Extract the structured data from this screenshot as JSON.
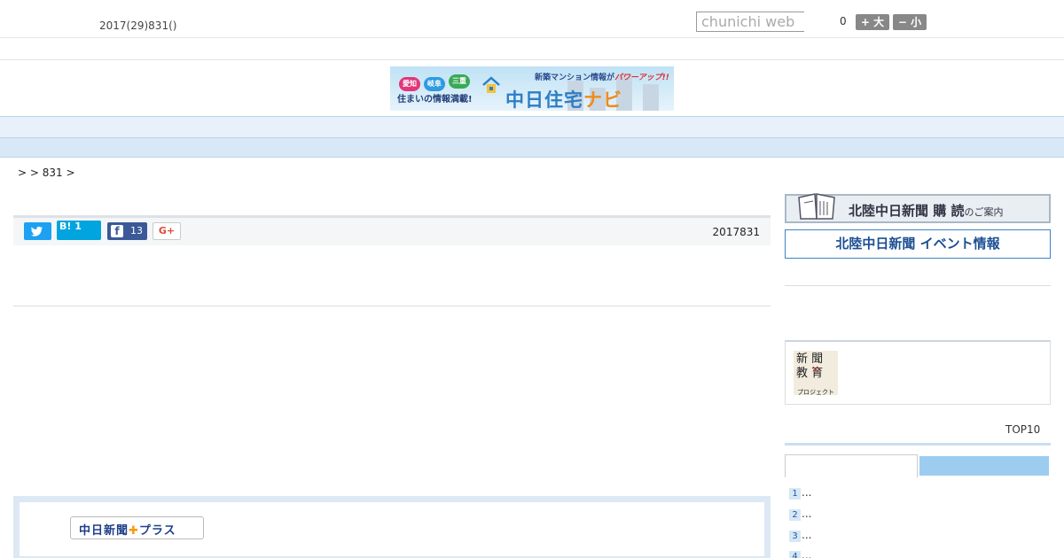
{
  "header": {
    "date": "2017(29)831()",
    "search_placeholder": "chunichi web",
    "font_size_value": "0",
    "font_large_label": "+ 大",
    "font_small_label": "− 小"
  },
  "banner": {
    "pills": [
      "愛知",
      "岐阜",
      "三重"
    ],
    "tagline_prefix": "新築マンション情報が",
    "tagline_emph": "パワーアップ!!",
    "subtitle": "住まいの情報満載!",
    "brand_main": "中日住宅",
    "brand_tail": "ナビ"
  },
  "nav": {
    "items": [
      "",
      "",
      "",
      "",
      "",
      "",
      "",
      "",
      ""
    ]
  },
  "breadcrumb": ">  > 831 >",
  "share": {
    "hatena_label": "B!",
    "hatena_count": "1",
    "facebook_count": "13",
    "gplus_label": "G+",
    "article_date": "2017831"
  },
  "plus": {
    "logo_main": "中日新聞",
    "logo_tail": "プラス"
  },
  "sidebar": {
    "subscribe_title": "北陸中日新聞 購 読",
    "subscribe_suffix": "のご案内",
    "event_title": "北陸中日新聞 イベント情報",
    "edu_line1": "新 聞",
    "edu_line2": "教 育",
    "edu_x": "×",
    "edu_project": "プロジェクト",
    "top10_label": "TOP10",
    "ranking": [
      {
        "num": "1",
        "text": "..."
      },
      {
        "num": "2",
        "text": "..."
      },
      {
        "num": "3",
        "text": "..."
      },
      {
        "num": "4",
        "text": "..."
      }
    ]
  }
}
